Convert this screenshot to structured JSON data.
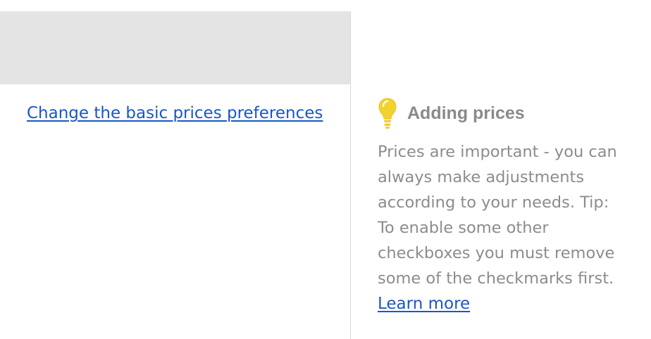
{
  "left": {
    "preferences_link": "Change the basic prices preferences"
  },
  "tip": {
    "icon": "lightbulb-icon",
    "title": "Adding prices",
    "lines": [
      "Prices are important - you can",
      "always make adjustments",
      "according to your needs. Tip:",
      "To enable some other",
      "checkboxes you must remove",
      "some of the checkmarks first."
    ],
    "learn_more": "Learn more"
  },
  "colors": {
    "link": "#1a56c8",
    "tip_text": "#8c8c8c",
    "bulb_yellow": "#f2d22e",
    "header_gray": "#e4e4e4"
  }
}
